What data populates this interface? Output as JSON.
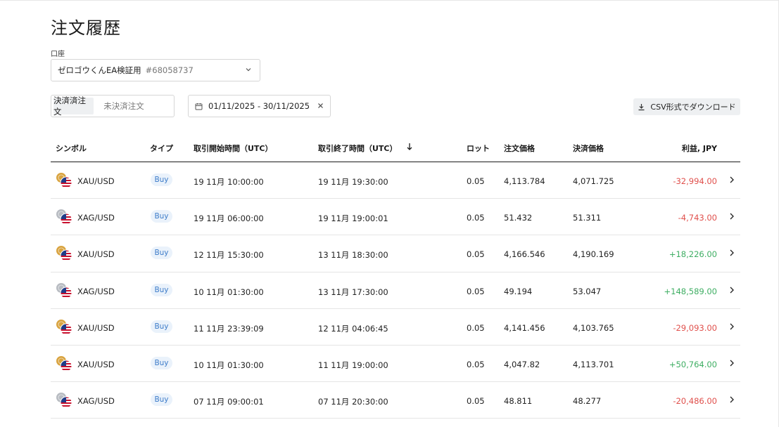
{
  "page": {
    "title": "注文履歴"
  },
  "account": {
    "label": "口座",
    "name": "ゼロゴウくんEA検証用",
    "number": "#68058737"
  },
  "tabs": [
    {
      "label": "決済済注文",
      "active": true
    },
    {
      "label": "未決済注文",
      "active": false
    }
  ],
  "date_range": {
    "value": "01/11/2025 - 30/11/2025"
  },
  "csv_button": {
    "label": "CSV形式でダウンロード"
  },
  "table": {
    "headers": {
      "symbol": "シンボル",
      "type": "タイプ",
      "open_time": "取引開始時間（UTC）",
      "close_time": "取引終了時間（UTC）",
      "lot": "ロット",
      "order_price": "注文価格",
      "close_price": "決済価格",
      "profit": "利益, JPY"
    },
    "rows": [
      {
        "symbol": "XAU/USD",
        "type": "Buy",
        "open": "19 11月 10:00:00",
        "close": "19 11月 19:30:00",
        "lot": "0.05",
        "order_price": "4,113.784",
        "close_price": "4,071.725",
        "profit": "-32,994.00",
        "metal": "gold"
      },
      {
        "symbol": "XAG/USD",
        "type": "Buy",
        "open": "19 11月 06:00:00",
        "close": "19 11月 19:00:01",
        "lot": "0.05",
        "order_price": "51.432",
        "close_price": "51.311",
        "profit": "-4,743.00",
        "metal": "silver"
      },
      {
        "symbol": "XAU/USD",
        "type": "Buy",
        "open": "12 11月 15:30:00",
        "close": "13 11月 18:30:00",
        "lot": "0.05",
        "order_price": "4,166.546",
        "close_price": "4,190.169",
        "profit": "+18,226.00",
        "metal": "gold"
      },
      {
        "symbol": "XAG/USD",
        "type": "Buy",
        "open": "10 11月 01:30:00",
        "close": "13 11月 17:30:00",
        "lot": "0.05",
        "order_price": "49.194",
        "close_price": "53.047",
        "profit": "+148,589.00",
        "metal": "silver"
      },
      {
        "symbol": "XAU/USD",
        "type": "Buy",
        "open": "11 11月 23:39:09",
        "close": "12 11月 04:06:45",
        "lot": "0.05",
        "order_price": "4,141.456",
        "close_price": "4,103.765",
        "profit": "-29,093.00",
        "metal": "gold"
      },
      {
        "symbol": "XAU/USD",
        "type": "Buy",
        "open": "10 11月 01:30:00",
        "close": "11 11月 19:00:00",
        "lot": "0.05",
        "order_price": "4,047.82",
        "close_price": "4,113.701",
        "profit": "+50,764.00",
        "metal": "gold"
      },
      {
        "symbol": "XAG/USD",
        "type": "Buy",
        "open": "07 11月 09:00:01",
        "close": "07 11月 20:30:00",
        "lot": "0.05",
        "order_price": "48.811",
        "close_price": "48.277",
        "profit": "-20,486.00",
        "metal": "silver"
      }
    ]
  },
  "colors": {
    "negative": "#e0504c",
    "positive": "#3fae63",
    "badge_text": "#3d7cc9",
    "badge_bg": "#eaf2fb",
    "gold": "#d9a441",
    "silver": "#b8bcc2"
  },
  "icons": {
    "account_dropdown": "chevron-down-icon",
    "date": "calendar-icon",
    "clear": "close-icon",
    "csv": "download-icon",
    "sort": "arrow-down-icon",
    "row_action": "chevron-right-icon"
  }
}
